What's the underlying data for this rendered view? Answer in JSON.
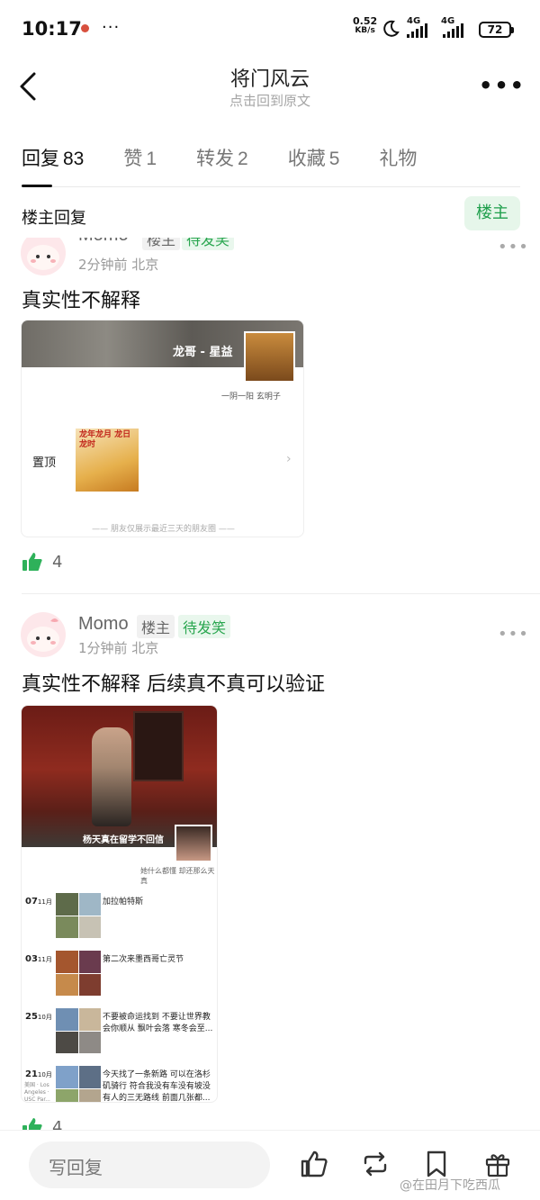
{
  "status_bar": {
    "time": "10:17",
    "more": "···",
    "speed_value": "0.52",
    "speed_unit": "KB/s",
    "sim1": "4G",
    "sim2": "4G",
    "battery": "72"
  },
  "nav": {
    "title": "将门风云",
    "subtitle": "点击回到原文",
    "more": "•••"
  },
  "tabs": [
    {
      "label": "回复",
      "count": "83",
      "active": true
    },
    {
      "label": "赞",
      "count": "1"
    },
    {
      "label": "转发",
      "count": "2"
    },
    {
      "label": "收藏",
      "count": "5"
    },
    {
      "label": "礼物",
      "count": ""
    }
  ],
  "section": {
    "label": "楼主回复",
    "owner_button": "楼主"
  },
  "posts": [
    {
      "username": "Momo",
      "badge_owner": "楼主",
      "badge_status": "待发笑",
      "meta": "2分钟前 北京",
      "text": "真实性不解释",
      "likes": "4",
      "moments_card": {
        "name": "龙哥 - 星益",
        "motto": "一阴一阳 玄明子",
        "pinned_label": "置顶",
        "thumb_text": "龙年龙月 龙日龙时",
        "footer": "—— 朋友仅展示最近三天的朋友圈 ——"
      }
    },
    {
      "username": "Momo",
      "badge_owner": "楼主",
      "badge_status": "待发笑",
      "meta": "1分钟前 北京",
      "text": "真实性不解释 后续真不真可以验证",
      "likes": "4",
      "moments_card": {
        "name": "杨天真在留学不回信",
        "signature": "她什么都懂 却还那么天真",
        "entries": [
          {
            "day": "07",
            "month": "11月",
            "text": "加拉帕特斯",
            "location": ""
          },
          {
            "day": "03",
            "month": "11月",
            "text": "第二次来墨西哥亡灵节",
            "location": ""
          },
          {
            "day": "25",
            "month": "10月",
            "text": "不要被命运找到 不要让世界教会你顺从 飘叶会落 寒冬会至...",
            "location": ""
          },
          {
            "day": "21",
            "month": "10月",
            "text": "今天找了一条新路 可以在洛杉矶骑行 符合我没有车没有坡没有人的三无路线 前面几张都...",
            "location": "美国 · Los Angeles · USC Par..."
          }
        ]
      }
    }
  ],
  "bottom_bar": {
    "reply_placeholder": "写回复",
    "watermark": "@在田月下吃西瓜"
  }
}
